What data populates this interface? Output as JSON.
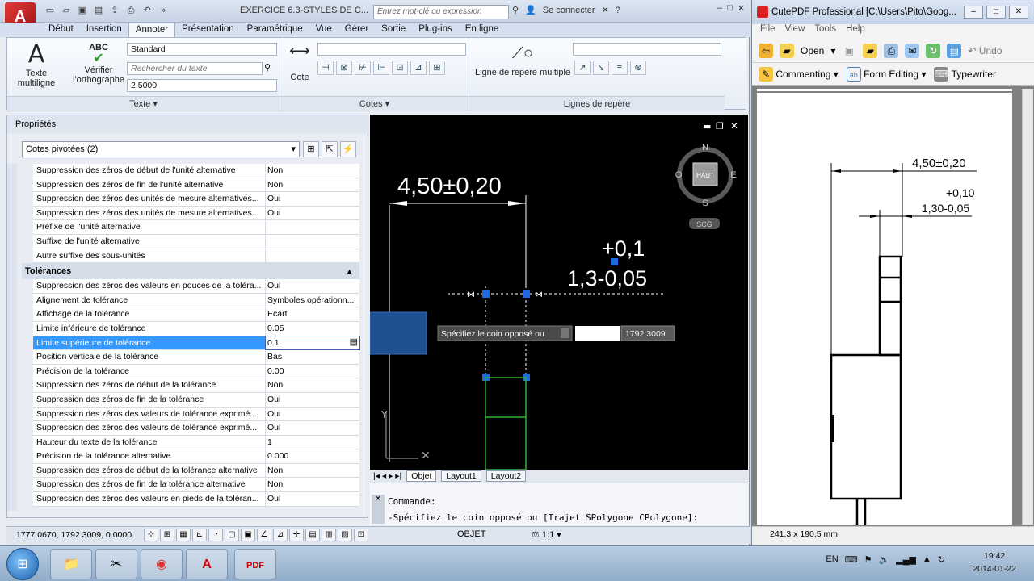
{
  "acad": {
    "logo": "A",
    "doc_title": "EXERCICE 6.3-STYLES DE C...",
    "search_placeholder": "Entrez mot-clé ou expression",
    "sign_in": "Se connecter",
    "tabs": [
      "Début",
      "Insertion",
      "Annoter",
      "Présentation",
      "Paramétrique",
      "Vue",
      "Gérer",
      "Sortie",
      "Plug-ins",
      "En ligne"
    ],
    "ribbon": {
      "text_panel": {
        "multiline_label1": "Texte",
        "multiline_label2": "multiligne",
        "spell_label1": "Vérifier",
        "spell_label2": "l'orthographe",
        "style_value": "Standard",
        "find_placeholder": "Rechercher du texte",
        "height_value": "2.5000",
        "footer": "Texte"
      },
      "dim_panel": {
        "cote_label": "Cote",
        "footer": "Cotes"
      },
      "leader_panel": {
        "multileader_label": "Ligne de repère multiple",
        "footer": "Lignes de repère"
      }
    },
    "properties": {
      "title": "Propriétés",
      "selection": "Cotes pivotées (2)",
      "rows_top": [
        {
          "k": "Suppression des zéros de début de l'unité alternative",
          "v": "Non"
        },
        {
          "k": "Suppression des zéros de fin de l'unité alternative",
          "v": "Non"
        },
        {
          "k": "Suppression des zéros des unités de mesure alternatives...",
          "v": "Oui"
        },
        {
          "k": "Suppression des zéros des unités de mesure alternatives...",
          "v": "Oui"
        },
        {
          "k": "Préfixe de l'unité alternative",
          "v": ""
        },
        {
          "k": "Suffixe de l'unité alternative",
          "v": ""
        },
        {
          "k": "Autre suffixe des sous-unités",
          "v": ""
        }
      ],
      "section_tolerances": "Tolérances",
      "rows_tol": [
        {
          "k": "Suppression des zéros des valeurs en pouces de la toléra...",
          "v": "Oui"
        },
        {
          "k": "Alignement de tolérance",
          "v": "Symboles opérationn..."
        },
        {
          "k": "Affichage de la tolérance",
          "v": "Ecart"
        },
        {
          "k": "Limite inférieure de tolérance",
          "v": "0.05"
        },
        {
          "k": "Limite supérieure de tolérance",
          "v": "0.1"
        },
        {
          "k": "Position verticale de la tolérance",
          "v": "Bas"
        },
        {
          "k": "Précision de la tolérance",
          "v": "0.00"
        },
        {
          "k": "Suppression des zéros de début de la tolérance",
          "v": "Non"
        },
        {
          "k": "Suppression des zéros de fin de la tolérance",
          "v": "Oui"
        },
        {
          "k": "Suppression des zéros des valeurs de tolérance exprimé...",
          "v": "Oui"
        },
        {
          "k": "Suppression des zéros des valeurs de tolérance exprimé...",
          "v": "Oui"
        },
        {
          "k": "Hauteur du texte de la tolérance",
          "v": "1"
        },
        {
          "k": "Précision de la tolérance alternative",
          "v": "0.000"
        },
        {
          "k": "Suppression des zéros de début de la tolérance alternative",
          "v": "Non"
        },
        {
          "k": "Suppression des zéros de fin de la tolérance alternative",
          "v": "Non"
        },
        {
          "k": "Suppression des zéros des valeurs en pieds de la toléran...",
          "v": "Oui"
        }
      ]
    },
    "drawing": {
      "dim_main": "4,50±0,20",
      "tol_plus": "+0,1",
      "tol_minus": "1,3-0,05",
      "prompt": "Spécifiez le coin opposé ou",
      "coord_input": "1792.3009",
      "viewcube_top": "HAUT",
      "viewcube_n": "N",
      "viewcube_s": "S",
      "viewcube_e": "E",
      "viewcube_o": "O",
      "wcs": "SCG"
    },
    "layout_tabs": [
      "Objet",
      "Layout1",
      "Layout2"
    ],
    "command": {
      "label": "Commande:",
      "line": "-Spécifiez le coin opposé ou [Trajet SPolygone CPolygone]:"
    },
    "status": {
      "coords": "1777.0670, 1792.3009, 0.0000",
      "model": "OBJET",
      "scale": "1:1"
    }
  },
  "pdf": {
    "title": "CutePDF Professional [C:\\Users\\Pito\\Goog...",
    "menu": [
      "File",
      "View",
      "Tools",
      "Help"
    ],
    "toolbar1": {
      "open": "Open",
      "undo": "Undo"
    },
    "toolbar2": {
      "commenting": "Commenting",
      "form_editing": "Form Editing",
      "typewriter": "Typewriter"
    },
    "page": {
      "dim_main": "4,50±0,20",
      "tol_plus": "+0,10",
      "tol_minus": "1,30-0,05"
    },
    "status": "241,3 x 190,5 mm"
  },
  "taskbar": {
    "lang": "EN",
    "time": "19:42",
    "date": "2014-01-22"
  }
}
